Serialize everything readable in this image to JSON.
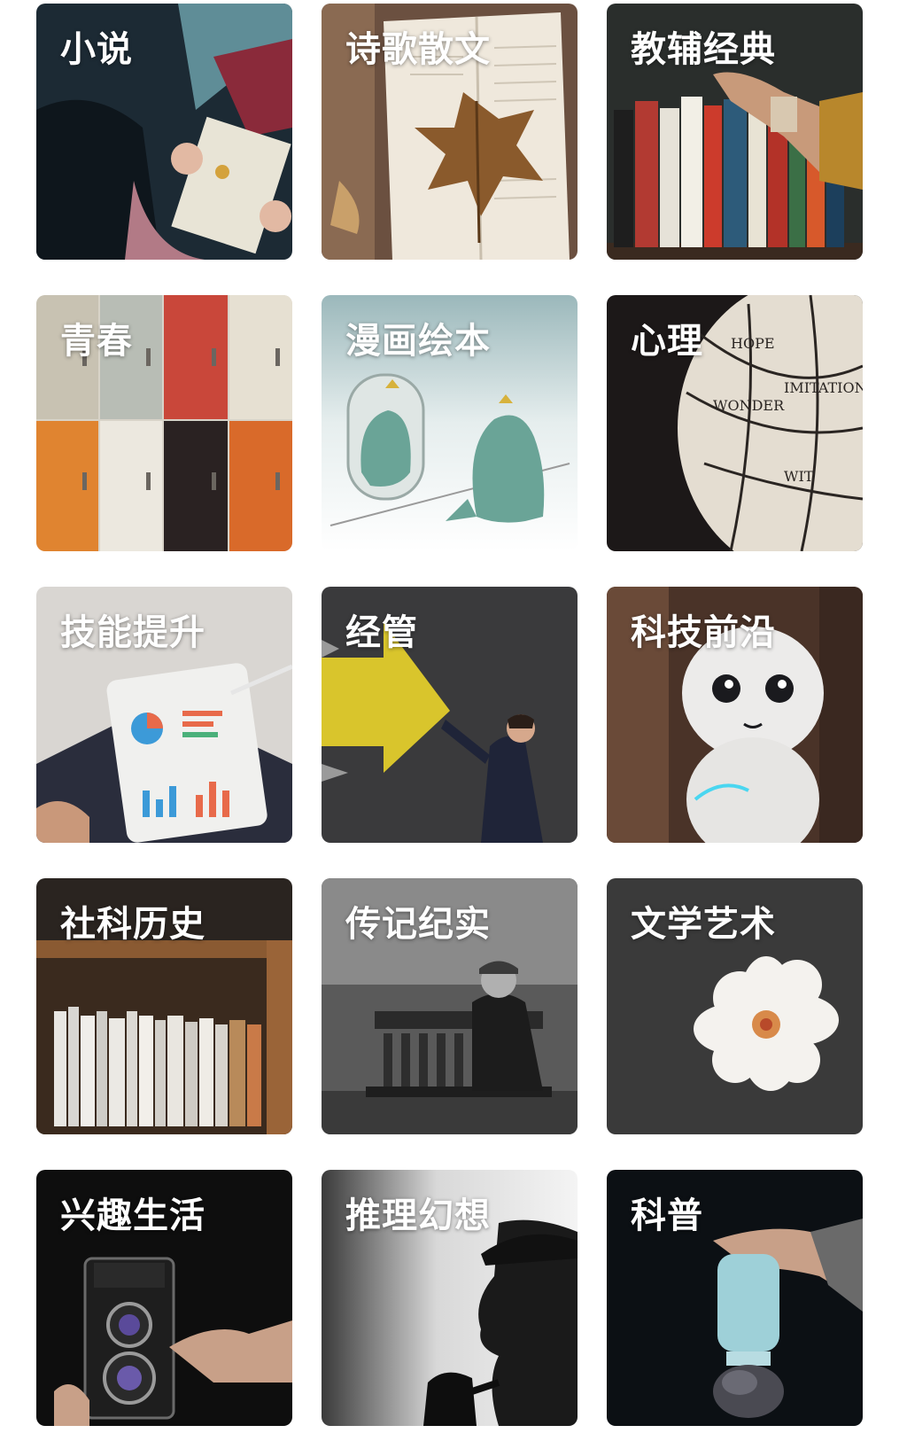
{
  "categories": [
    {
      "label": "小说",
      "icon": "reading-girl-photo"
    },
    {
      "label": "诗歌散文",
      "icon": "leaf-on-book-photo"
    },
    {
      "label": "教辅经典",
      "icon": "bookshelf-hand-photo"
    },
    {
      "label": "青春",
      "icon": "colorful-lockers-photo"
    },
    {
      "label": "漫画绘本",
      "icon": "dinosaur-mirror-illustration"
    },
    {
      "label": "心理",
      "icon": "phrenology-head-photo"
    },
    {
      "label": "技能提升",
      "icon": "tablet-charts-photo"
    },
    {
      "label": "经管",
      "icon": "businessman-arrow-photo"
    },
    {
      "label": "科技前沿",
      "icon": "robot-photo"
    },
    {
      "label": "社科历史",
      "icon": "wooden-bookcase-photo"
    },
    {
      "label": "传记纪实",
      "icon": "old-man-bench-photo"
    },
    {
      "label": "文学艺术",
      "icon": "white-flower-photo"
    },
    {
      "label": "兴趣生活",
      "icon": "vintage-camera-photo"
    },
    {
      "label": "推理幻想",
      "icon": "detective-silhouette-photo"
    },
    {
      "label": "科普",
      "icon": "glass-jar-photo"
    }
  ]
}
